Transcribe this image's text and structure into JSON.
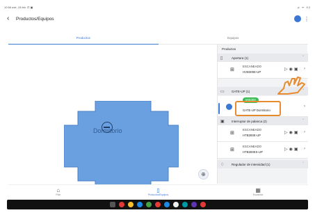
{
  "status_bar": {
    "left": "10:56 mié, 15 feb. ⊡ ▣",
    "right": "⊿ ᯤ 92"
  },
  "header": {
    "title": "Productos/Equipos",
    "back_icon": "arrow-left-icon",
    "more_icon": "kebab-icon"
  },
  "tabs": [
    {
      "label": "Productos",
      "active": true
    },
    {
      "label": "Equipos",
      "active": false
    }
  ],
  "map": {
    "room_label": "Dormitorio",
    "room_color": "#6a9fe0"
  },
  "panel": {
    "title": "Productos",
    "categories": [
      {
        "label": "Apertura (1)",
        "icon": "door-icon"
      },
      {
        "label": "GATE-UP (1)",
        "icon": "gate-icon"
      },
      {
        "label": "Interruptor de palanca (2)",
        "icon": "switch-icon"
      },
      {
        "label": "Regulador de intensidad (1)",
        "icon": "bulb-icon"
      }
    ],
    "devices": [
      {
        "status": "ESCANEADO",
        "name": "HVB300E-UP"
      },
      {
        "status": "MIS300",
        "name": "GATE-UP Dormitorio"
      },
      {
        "status": "ESCANEADO",
        "name": "HTB300E-UP"
      },
      {
        "status": "ESCANEADO",
        "name": "HTB300ES-UP"
      }
    ]
  },
  "bottom_nav": [
    {
      "label": "Plan",
      "icon": "plan-icon",
      "active": false
    },
    {
      "label": "Productos/Equipos",
      "icon": "product-icon",
      "active": true
    },
    {
      "label": "Escanear",
      "icon": "qr-icon",
      "active": false
    }
  ],
  "colors": {
    "accent": "#3a78d6",
    "highlight": "#e88a2e",
    "ok": "#3dbb57"
  }
}
